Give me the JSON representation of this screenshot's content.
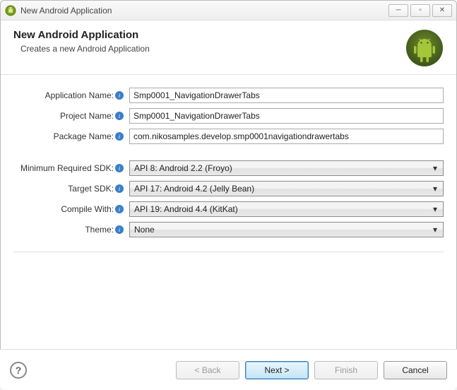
{
  "window": {
    "title": "New Android Application"
  },
  "header": {
    "title": "New Android Application",
    "subtitle": "Creates a new Android Application"
  },
  "form": {
    "appName": {
      "label": "Application Name:",
      "value": "Smp0001_NavigationDrawerTabs"
    },
    "projectName": {
      "label": "Project Name:",
      "value": "Smp0001_NavigationDrawerTabs"
    },
    "packageName": {
      "label": "Package Name:",
      "value": "com.nikosamples.develop.smp0001navigationdrawertabs"
    },
    "minSdk": {
      "label": "Minimum Required SDK:",
      "value": "API 8: Android 2.2 (Froyo)"
    },
    "targetSdk": {
      "label": "Target SDK:",
      "value": "API 17: Android 4.2 (Jelly Bean)"
    },
    "compileWith": {
      "label": "Compile With:",
      "value": "API 19: Android 4.4 (KitKat)"
    },
    "theme": {
      "label": "Theme:",
      "value": "None"
    }
  },
  "buttons": {
    "back": "< Back",
    "next": "Next >",
    "finish": "Finish",
    "cancel": "Cancel"
  },
  "icons": {
    "info": "i",
    "help": "?"
  },
  "colors": {
    "android_green": "#a4c639"
  }
}
